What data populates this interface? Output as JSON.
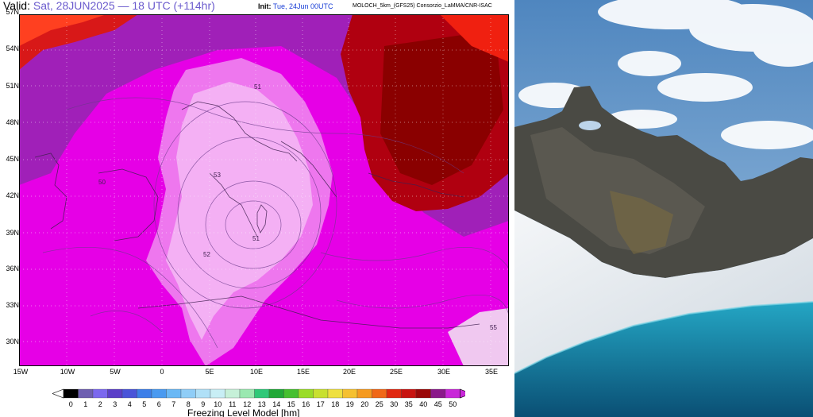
{
  "header": {
    "valid_label": "Valid:",
    "valid_time": "Sat, 28JUN2025 — 18 UTC (+114hr)",
    "init_label": "Init:",
    "init_time": "Tue, 24Jun 00UTC",
    "model": "MOLOCH_5km_(GFS25) Consorzio_LaMMA/CNR-ISAC"
  },
  "map": {
    "lat_labels": [
      "57N",
      "54N",
      "51N",
      "48N",
      "45N",
      "42N",
      "39N",
      "36N",
      "33N",
      "30N"
    ],
    "lon_labels": [
      "15W",
      "10W",
      "5W",
      "0",
      "5E",
      "10E",
      "15E",
      "20E",
      "25E",
      "30E",
      "35E"
    ],
    "contour_labels": [
      "51",
      "53",
      "50",
      "52",
      "51",
      "55"
    ]
  },
  "legend": {
    "levels": [
      "0",
      "1",
      "2",
      "3",
      "4",
      "5",
      "6",
      "7",
      "8",
      "9",
      "10",
      "11",
      "12",
      "13",
      "14",
      "15",
      "16",
      "17",
      "18",
      "19",
      "20",
      "25",
      "30",
      "35",
      "40",
      "45",
      "50"
    ],
    "colors": [
      "#000000",
      "#6e5fb0",
      "#7b68ee",
      "#5b3fc8",
      "#4a54d8",
      "#3d7fe8",
      "#4a9af0",
      "#6ab8f5",
      "#8fcdf7",
      "#b0e0f7",
      "#c8eef5",
      "#c6f0d8",
      "#9ae8b0",
      "#2fc878",
      "#22a838",
      "#46c030",
      "#9adc28",
      "#c8e030",
      "#eee040",
      "#f5c030",
      "#f59a20",
      "#f06818",
      "#e02810",
      "#c81410",
      "#9a0808",
      "#8a1a8a",
      "#c828d8"
    ],
    "title": "Freezing Level Model [hm]"
  }
}
